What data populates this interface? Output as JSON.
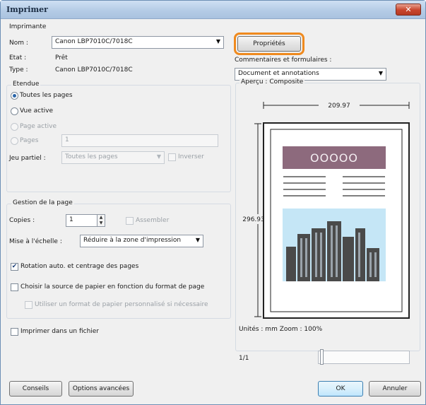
{
  "window": {
    "title": "Imprimer",
    "close_glyph": "✕"
  },
  "printer": {
    "group_label": "Imprimante",
    "name_label": "Nom :",
    "name_value": "Canon LBP7010C/7018C",
    "status_label": "Etat :",
    "status_value": "Prêt",
    "type_label": "Type :",
    "type_value": "Canon LBP7010C/7018C",
    "properties_button": "Propriétés",
    "comments_label": "Commentaires et formulaires :",
    "comments_value": "Document et annotations"
  },
  "range": {
    "group_label": "Etendue",
    "options": [
      "Toutes les pages",
      "Vue active",
      "Page active",
      "Pages"
    ],
    "selected_index": 0,
    "pages_value": "1",
    "subset_label": "Jeu partiel :",
    "subset_value": "Toutes les pages",
    "reverse_label": "Inverser"
  },
  "page_handling": {
    "group_label": "Gestion de la page",
    "copies_label": "Copies :",
    "copies_value": "1",
    "collate_label": "Assembler",
    "scaling_label": "Mise à l'échelle :",
    "scaling_value": "Réduire à la zone d'impression",
    "autorotate_label": "Rotation auto. et centrage des pages",
    "autorotate_checked": true,
    "paper_source_label": "Choisir la source de papier en fonction du format de page",
    "paper_source_checked": false,
    "custom_paper_label": "Utiliser un format de papier personnalisé si nécessaire",
    "custom_paper_checked": false
  },
  "print_to_file": {
    "label": "Imprimer dans un fichier",
    "checked": false
  },
  "preview": {
    "label": "Aperçu : Composite",
    "width_value": "209.97",
    "height_value": "296.93",
    "units_text": "Unités : mm Zoom : 100%",
    "page_indicator": "1/1",
    "page_position": 0.0,
    "graphic_text": "OOOOO",
    "colors": {
      "band": "#8d6a7d",
      "sky": "#c5e6f6",
      "building": "#4a4a4a"
    }
  },
  "footer": {
    "tips_button": "Conseils",
    "advanced_button": "Options avancées",
    "ok_button": "OK",
    "cancel_button": "Annuler"
  },
  "icons": {
    "dropdown": "dropdown-arrow-icon",
    "checkmark": "checkmark-icon",
    "spin": "spin-arrows-icon"
  },
  "colors": {
    "highlight": "#ef8a1e",
    "titlebar": "#b5cce6"
  }
}
